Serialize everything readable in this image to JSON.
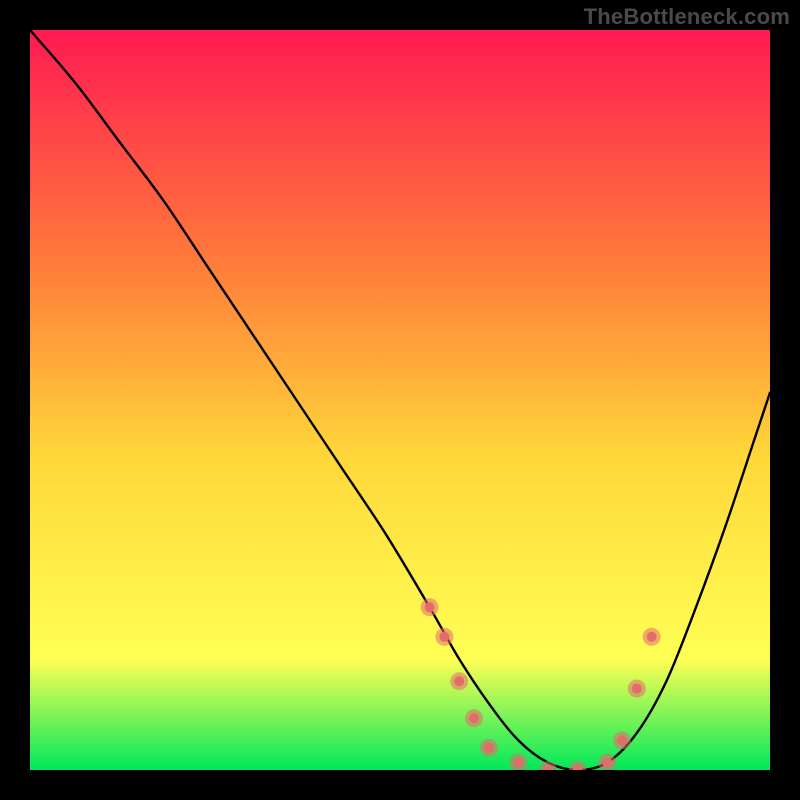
{
  "watermark": "TheBottleneck.com",
  "chart_data": {
    "type": "line",
    "title": "",
    "xlabel": "",
    "ylabel": "",
    "xlim": [
      0,
      100
    ],
    "ylim": [
      0,
      100
    ],
    "grid": false,
    "legend": false,
    "background_gradient": {
      "top_color": "#ff1a52",
      "mid_color_1": "#ff7d3a",
      "mid_color_2": "#ffd83a",
      "mid_color_3": "#ffff55",
      "bottom_color": "#00e85a"
    },
    "series": [
      {
        "name": "bottleneck-curve",
        "color": "#000000",
        "x": [
          0,
          6,
          12,
          18,
          24,
          30,
          36,
          42,
          48,
          54,
          58,
          62,
          66,
          70,
          74,
          78,
          82,
          86,
          90,
          94,
          98,
          100
        ],
        "y": [
          100,
          93,
          85,
          77,
          68,
          59,
          50,
          41,
          32,
          22,
          15,
          9,
          4,
          1,
          0,
          1,
          5,
          12,
          22,
          33,
          45,
          51
        ]
      }
    ],
    "markers": {
      "name": "highlight-points",
      "color": "#e36b6b",
      "radius_outer": 9,
      "radius_inner": 5,
      "points": [
        {
          "x": 54,
          "y": 22
        },
        {
          "x": 56,
          "y": 18
        },
        {
          "x": 58,
          "y": 12
        },
        {
          "x": 60,
          "y": 7
        },
        {
          "x": 62,
          "y": 3
        },
        {
          "x": 66,
          "y": 1
        },
        {
          "x": 70,
          "y": 0
        },
        {
          "x": 74,
          "y": 0
        },
        {
          "x": 78,
          "y": 1
        },
        {
          "x": 80,
          "y": 4
        },
        {
          "x": 82,
          "y": 11
        },
        {
          "x": 84,
          "y": 18
        }
      ]
    }
  }
}
